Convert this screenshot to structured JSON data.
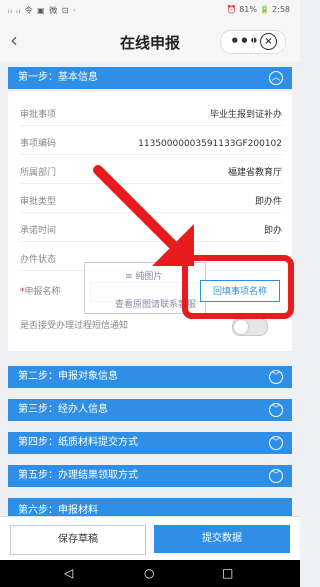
{
  "status_bar": {
    "left": "ᵢₗ ᵢₗ 令 ▣ 微 ⊡ ·",
    "right": "⏰ 81% 🔋 2:58"
  },
  "nav": {
    "back_icon": "chevron-left",
    "title": "在线申报",
    "more_label": "•••",
    "close_label": "×"
  },
  "steps": {
    "step1": {
      "label": "第一步：基本信息",
      "expanded": true
    },
    "step2": {
      "label": "第二步：申报对象信息"
    },
    "step3": {
      "label": "第三步：经办人信息"
    },
    "step4": {
      "label": "第四步：纸质材料提交方式"
    },
    "step5": {
      "label": "第五步：办理结果领取方式"
    },
    "step6": {
      "label": "第六步：申报材料"
    }
  },
  "basic_info": {
    "rows": [
      {
        "label": "审批事项",
        "value": "毕业生报到证补办"
      },
      {
        "label": "事项编码",
        "value": "11350000003591133GF200102"
      },
      {
        "label": "所属部门",
        "value": "福建省教育厅"
      },
      {
        "label": "审批类型",
        "value": "即办件"
      },
      {
        "label": "承诺时间",
        "value": "即办"
      },
      {
        "label": "办件状态",
        "value": ""
      }
    ],
    "apply_name_label": "申报名称",
    "apply_name_required": "*",
    "choose_button": "回填事项名称",
    "sms_label": "是否接受办理过程短信通知",
    "sms_enabled": false
  },
  "watermark": {
    "line1": "≋ 纯图片",
    "line2": "查看原图请联系客服"
  },
  "footer": {
    "save": "保存草稿",
    "submit": "提交数据"
  },
  "system_nav": {
    "back": "◁",
    "home": "○",
    "recent": "□"
  },
  "colors": {
    "accent": "#2f8fe6",
    "highlight": "#e81c1c"
  }
}
